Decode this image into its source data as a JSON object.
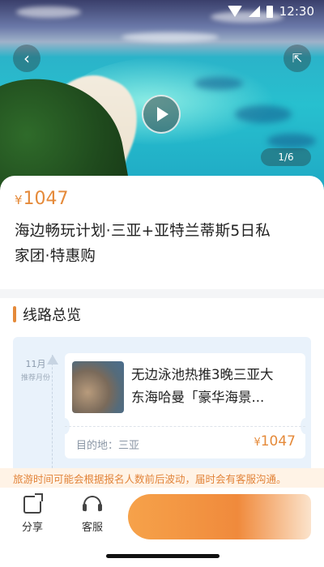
{
  "status_bar": {
    "time": "12:30"
  },
  "hero": {
    "page_indicator": "1/6"
  },
  "product": {
    "currency": "¥",
    "price": "1047",
    "title_line1": "海边畅玩计划·三亚+亚特兰蒂斯5日私",
    "title_line2": "家团·特惠购"
  },
  "route": {
    "section_title": "线路总览",
    "month": "11月",
    "month_sub": "推荐月份",
    "trip": {
      "title_line1": "无边泳池热推3晚三亚大",
      "title_line2": "东海哈曼「豪华海景...",
      "destination": "目的地：三亚",
      "currency": "¥",
      "price": "1047"
    }
  },
  "notice": "旅游时间可能会根据报名人数前后波动，届时会有客服沟通。",
  "bottom_bar": {
    "share_label": "分享",
    "service_label": "客服"
  }
}
